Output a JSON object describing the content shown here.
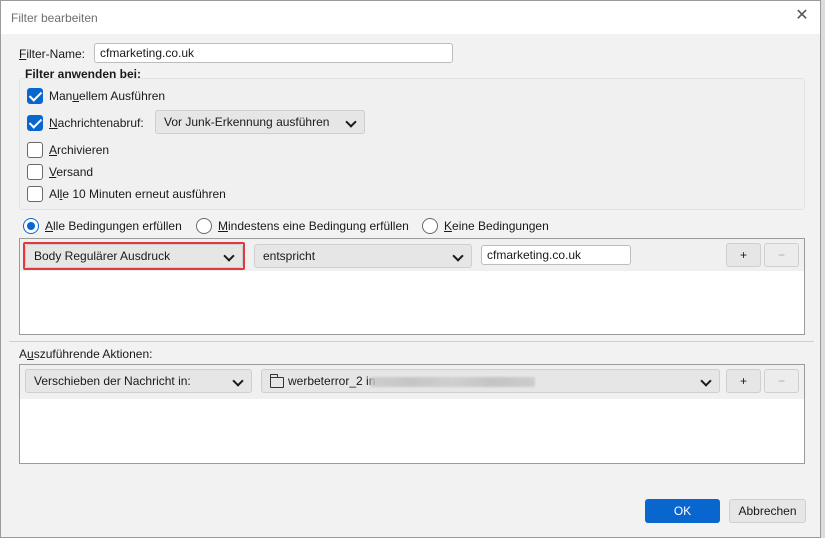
{
  "window": {
    "title": "Filter bearbeiten"
  },
  "filter_name": {
    "label": "Filter-Name:",
    "value": "cfmarketing.co.uk"
  },
  "apply": {
    "heading": "Filter anwenden bei:",
    "manual": {
      "label": "Manuellem Ausführen",
      "checked": true
    },
    "fetch": {
      "label": "Nachrichtenabruf:",
      "checked": true,
      "select": "Vor Junk-Erkennung ausführen"
    },
    "archive": {
      "label": "Archivieren",
      "checked": false
    },
    "send": {
      "label": "Versand",
      "checked": false
    },
    "periodic": {
      "label": "Alle 10 Minuten erneut ausführen",
      "checked": false
    }
  },
  "match": {
    "all": "Alle Bedingungen erfüllen",
    "any": "Mindestens eine Bedingung erfüllen",
    "none": "Keine Bedingungen",
    "selected": "all"
  },
  "condition": {
    "field": "Body Regulärer Ausdruck",
    "operator": "entspricht",
    "value": "cfmarketing.co.uk",
    "add": "+",
    "remove": "−"
  },
  "actions": {
    "heading": "Auszuführende Aktionen:",
    "action": "Verschieben der Nachricht in:",
    "target": "werbeterror_2 in",
    "add": "+",
    "remove": "−"
  },
  "footer": {
    "ok": "OK",
    "cancel": "Abbrechen"
  },
  "colors": {
    "accent": "#0a66cf",
    "highlight": "#e0383c"
  },
  "icons": {
    "close": "close-icon",
    "folder": "folder-icon",
    "dropdown": "chevron-down-icon"
  }
}
